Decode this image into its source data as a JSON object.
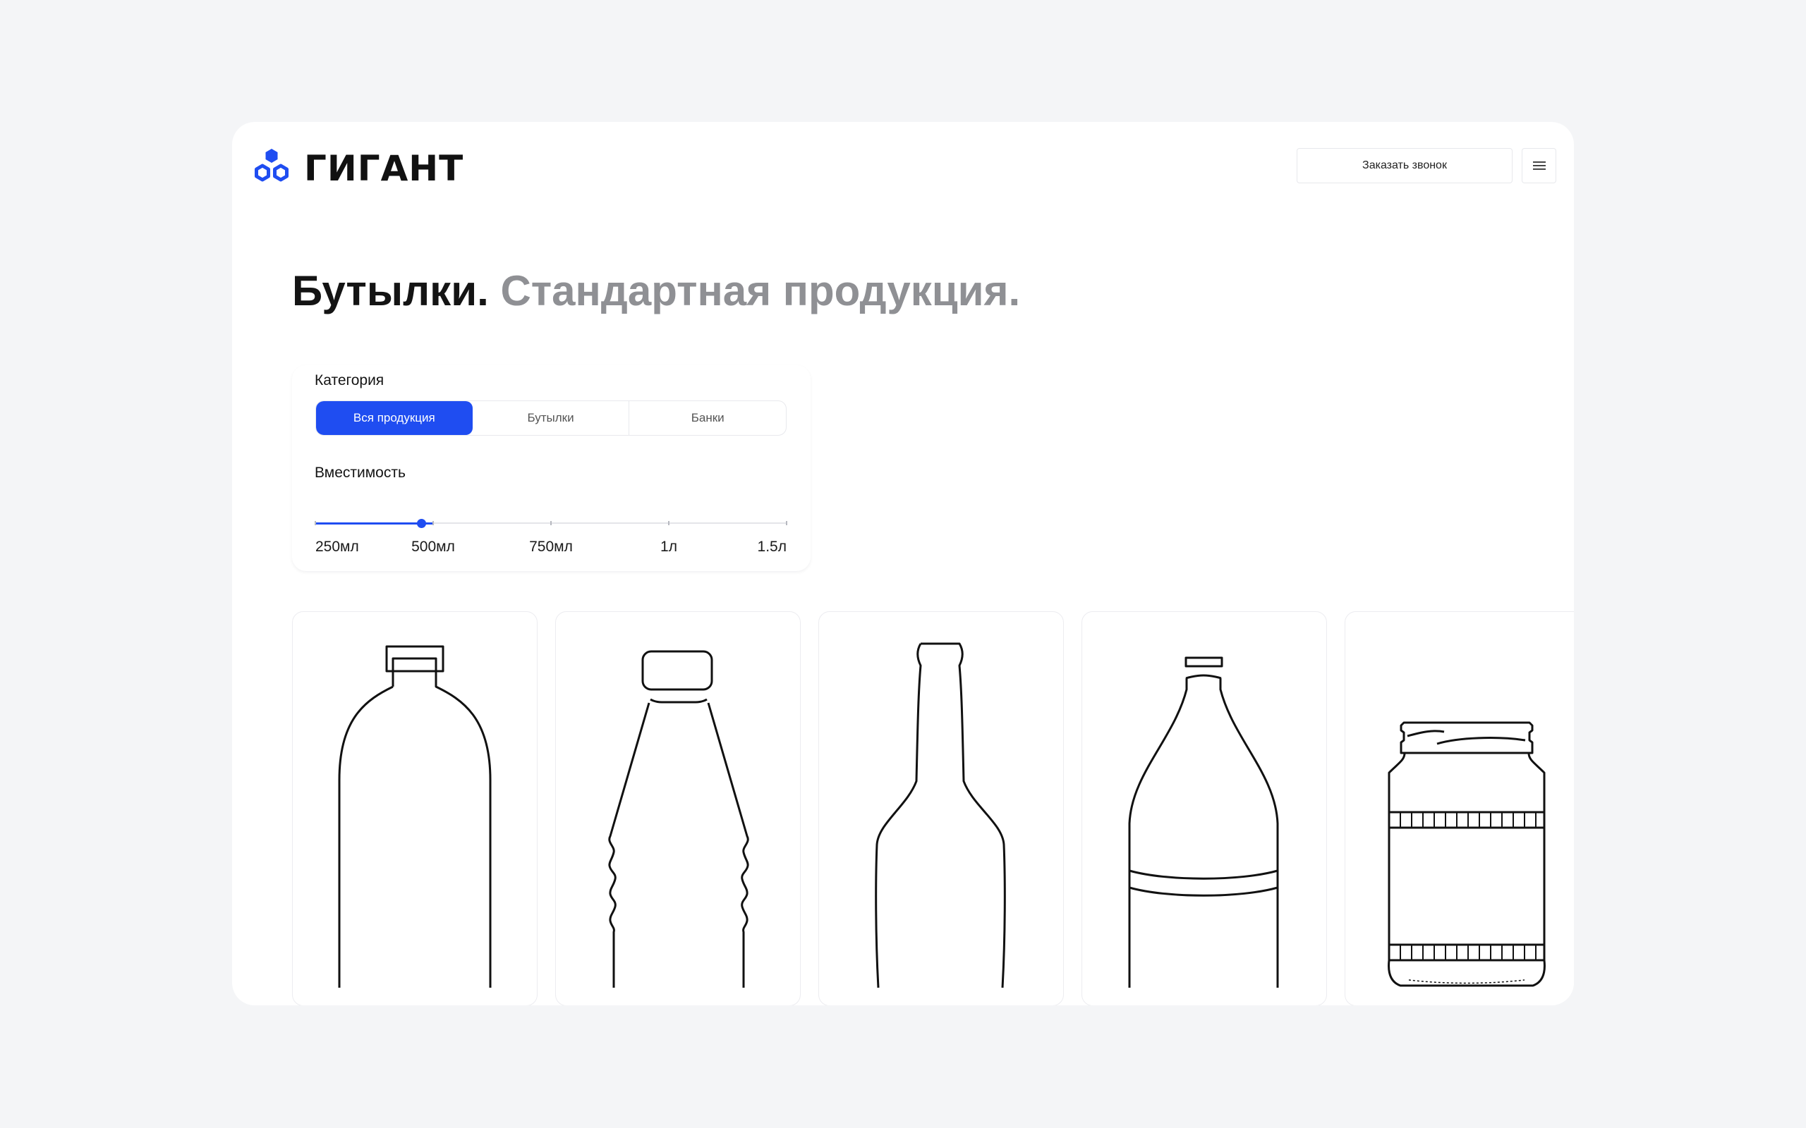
{
  "header": {
    "logo_text": "ГИГАНТ",
    "logo_icon": "hexagon-cluster-icon",
    "callback_label": "Заказать звонок",
    "menu_icon": "hamburger-menu-icon"
  },
  "headline": {
    "bold": "Бутылки.",
    "light": "Стандартная продукция."
  },
  "filters": {
    "category_label": "Категория",
    "categories": [
      {
        "label": "Вся продукция",
        "active": true
      },
      {
        "label": "Бутылки",
        "active": false
      },
      {
        "label": "Банки",
        "active": false
      }
    ],
    "capacity_label": "Вместимость",
    "capacity_options": [
      "250мл",
      "500мл",
      "750мл",
      "1л",
      "1.5л"
    ],
    "capacity_selected": "500мл"
  },
  "products": [
    {
      "icon": "bottle-round-shoulder-icon"
    },
    {
      "icon": "bottle-ribbed-icon"
    },
    {
      "icon": "bottle-long-neck-icon"
    },
    {
      "icon": "bottle-large-labeled-icon"
    },
    {
      "icon": "jar-icon"
    }
  ],
  "colors": {
    "accent": "#1f4df1",
    "background": "#f4f5f7",
    "headline_dark": "#141414",
    "headline_gray": "#8f9094"
  }
}
